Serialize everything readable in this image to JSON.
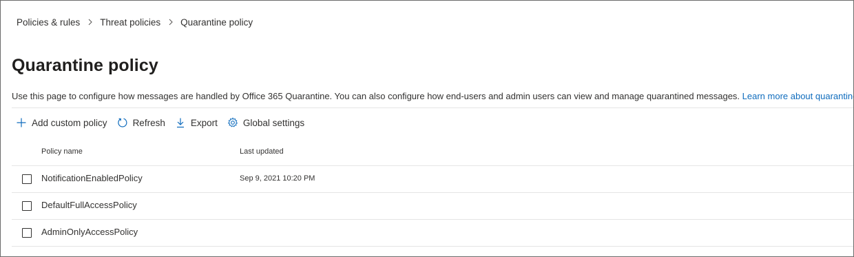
{
  "breadcrumb": [
    {
      "label": "Policies & rules"
    },
    {
      "label": "Threat policies"
    },
    {
      "label": "Quarantine policy"
    }
  ],
  "page": {
    "title": "Quarantine policy",
    "description": "Use this page to configure how messages are handled by Office 365 Quarantine. You can also configure how end-users and admin users can view and manage quarantined messages.",
    "learn_more": "Learn more about quarantine policy"
  },
  "toolbar": {
    "add_label": "Add custom policy",
    "refresh_label": "Refresh",
    "export_label": "Export",
    "global_settings_label": "Global settings"
  },
  "table": {
    "columns": [
      "Policy name",
      "Last updated"
    ],
    "rows": [
      {
        "name": "NotificationEnabledPolicy",
        "last_updated": "Sep 9, 2021 10:20 PM"
      },
      {
        "name": "DefaultFullAccessPolicy",
        "last_updated": ""
      },
      {
        "name": "AdminOnlyAccessPolicy",
        "last_updated": ""
      }
    ]
  },
  "colors": {
    "link": "#0f6cbd",
    "icon": "#0f6cbd",
    "text": "#323130",
    "divider": "#e5e5e5"
  },
  "icons": [
    "chevron-right-icon",
    "add-icon",
    "refresh-icon",
    "download-icon",
    "gear-icon"
  ]
}
